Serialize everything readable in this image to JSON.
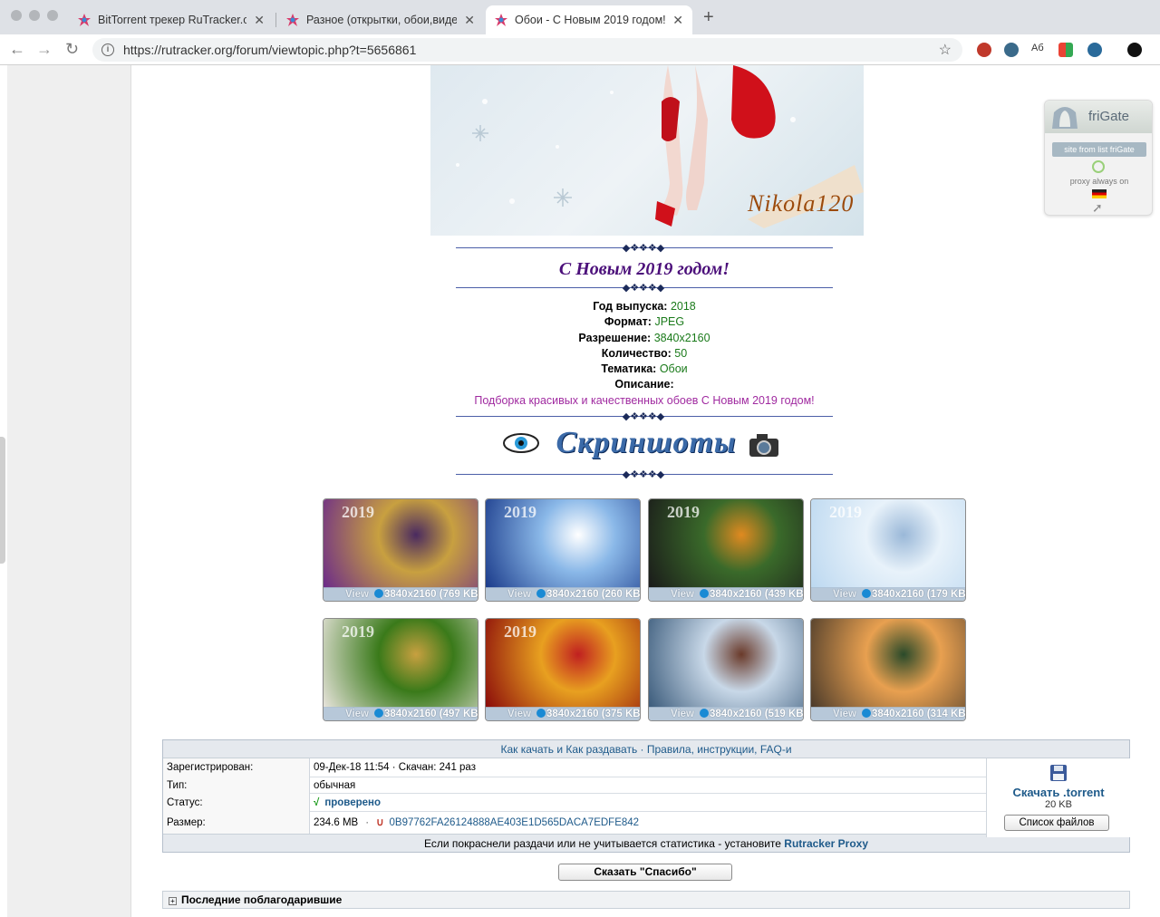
{
  "browser": {
    "tabs": [
      {
        "title": "BitTorrent трекер RuTracker.org",
        "active": false
      },
      {
        "title": "Разное (открытки, обои,видео)",
        "active": false
      },
      {
        "title": "Обои - С Новым 2019 годом!",
        "active": true
      }
    ],
    "url": "https://rutracker.org/forum/viewtopic.php?t=5656861"
  },
  "frigate": {
    "name": "friGate",
    "badge": "site from list friGate",
    "proxy": "proxy always on"
  },
  "post": {
    "signature": "Nikola120",
    "title": "С Новым 2019 годом!",
    "specs": [
      {
        "label": "Год выпуска:",
        "value": "2018"
      },
      {
        "label": "Формат:",
        "value": "JPEG"
      },
      {
        "label": "Разрешение:",
        "value": "3840x2160"
      },
      {
        "label": "Количество:",
        "value": "50"
      },
      {
        "label": "Тематика:",
        "value": "Обои"
      },
      {
        "label": "Описание:",
        "value": ""
      }
    ],
    "description": "Подборка красивых и качественных обоев С Новым 2019 годом!",
    "screenshots_label": "Скриншоты",
    "thumbs": [
      {
        "view": "View",
        "info": "3840x2160 (769 KB",
        "colors": [
          "#6b2a8a",
          "#c8a040",
          "#4a2a60"
        ],
        "year": "2019"
      },
      {
        "view": "View",
        "info": "3840x2160 (260 KB",
        "colors": [
          "#1a3a8a",
          "#8ab8e8",
          "#ffffff"
        ],
        "year": "2019"
      },
      {
        "view": "View",
        "info": "3840x2160 (439 KB",
        "colors": [
          "#1a1a1a",
          "#3a6a2a",
          "#e08a20"
        ],
        "year": "2019"
      },
      {
        "view": "View",
        "info": "3840x2160 (179 KB",
        "colors": [
          "#bcd8f0",
          "#e8f2fa",
          "#9ab8d8"
        ],
        "year": "2019"
      },
      {
        "view": "View",
        "info": "3840x2160 (497 KB",
        "colors": [
          "#e8e4dc",
          "#3a7a1a",
          "#c8a040"
        ],
        "year": "2019"
      },
      {
        "view": "View",
        "info": "3840x2160 (375 KB",
        "colors": [
          "#8a0a0a",
          "#e8a020",
          "#c02020"
        ],
        "year": "2019"
      },
      {
        "view": "View",
        "info": "3840x2160 (519 KB",
        "colors": [
          "#3a5a7a",
          "#c8d8e8",
          "#6a3a2a"
        ],
        "year": ""
      },
      {
        "view": "View",
        "info": "3840x2160 (314 KB",
        "colors": [
          "#4a3a2a",
          "#e8a050",
          "#2a4a2a"
        ],
        "year": ""
      }
    ]
  },
  "torrent": {
    "header": "Как качать и Как раздавать  ·  Правила, инструкции, FAQ-и",
    "rows": [
      {
        "key": "Зарегистрирован:",
        "value": "09-Дек-18 11:54  ·  Скачан: 241 раз"
      },
      {
        "key": "Тип:",
        "value": "обычная"
      },
      {
        "key": "Статус:",
        "value": "проверено"
      },
      {
        "key": "Размер:",
        "value": "234.6 MB"
      }
    ],
    "status_mark": "√",
    "hash": "0B97762FA26124888AE403E1D565DACA7EDFE842",
    "download_label": "Скачать .torrent",
    "download_size": "20 KB",
    "files_button": "Список файлов",
    "footer_text": "Если покраснели раздачи или не учитывается статистика - установите",
    "footer_link": "Rutracker Proxy",
    "thanks_button": "Сказать \"Спасибо\"",
    "last_thanked": "Последние поблагодарившие"
  },
  "colors": {
    "link": "#1e5a8a",
    "value_green": "#1a7a1a",
    "desc_purple": "#a02aa0",
    "title_purple": "#4b0f7a"
  }
}
